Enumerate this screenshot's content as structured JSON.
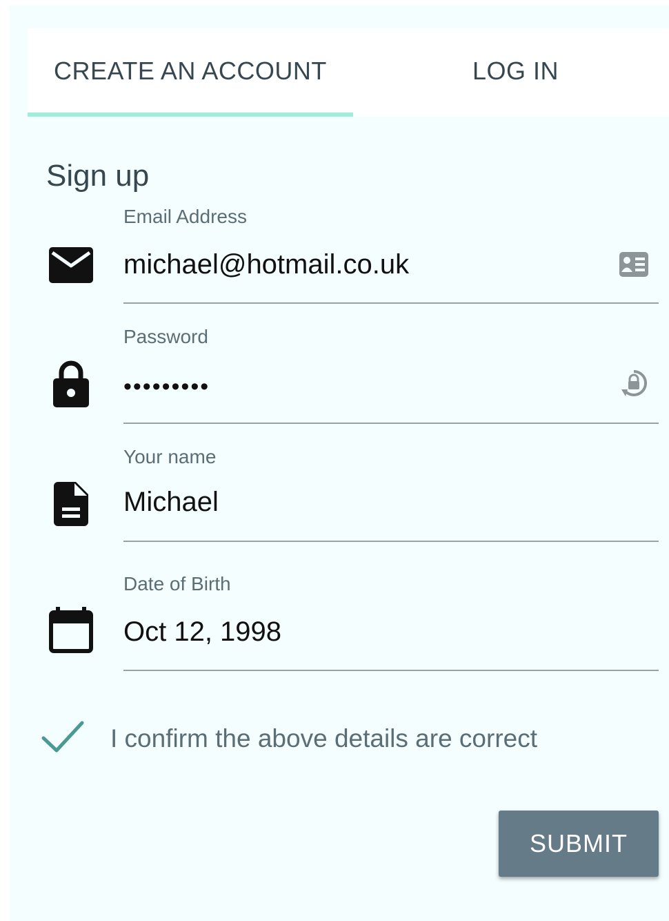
{
  "tabs": {
    "create_account": "CREATE AN ACCOUNT",
    "log_in": "LOG IN",
    "active": "create_account",
    "indicator_color": "#9deedb"
  },
  "form": {
    "heading": "Sign up",
    "email": {
      "label": "Email Address",
      "value": "michael@hotmail.co.uk",
      "icon": "email-icon",
      "trailing_icon": "contact-card-icon"
    },
    "password": {
      "label": "Password",
      "value": "•••••••••",
      "icon": "lock-icon",
      "trailing_icon": "password-lock-icon"
    },
    "name": {
      "label": "Your name",
      "value": "Michael",
      "icon": "document-icon"
    },
    "dob": {
      "label": "Date of Birth",
      "value": "Oct 12, 1998",
      "icon": "calendar-icon"
    },
    "confirm": {
      "label": "I confirm the above details are correct",
      "checked": true,
      "check_color": "#4a9a93"
    },
    "submit_label": "SUBMIT"
  },
  "colors": {
    "background": "#f4fefe",
    "button": "#667b88",
    "label": "#5b6d75"
  }
}
